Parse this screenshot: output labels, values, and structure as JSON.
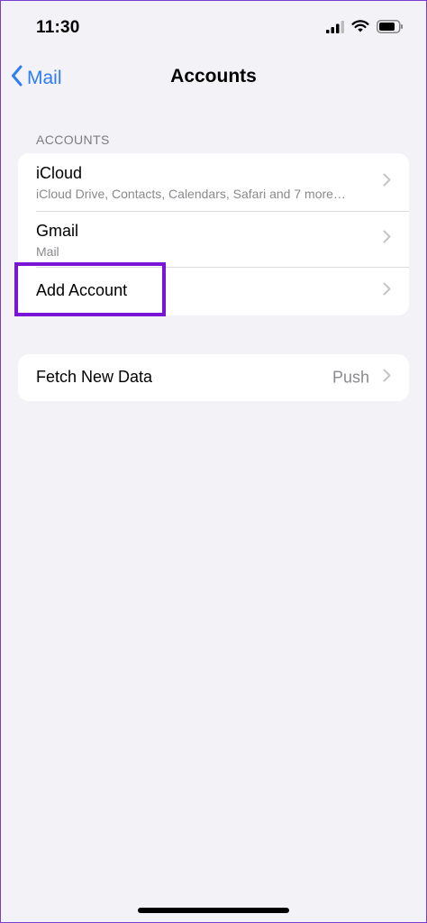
{
  "status_bar": {
    "time": "11:30"
  },
  "nav": {
    "back_label": "Mail",
    "title": "Accounts"
  },
  "accounts_section": {
    "header": "ACCOUNTS",
    "items": [
      {
        "title": "iCloud",
        "subtitle": "iCloud Drive, Contacts, Calendars, Safari and 7 more…"
      },
      {
        "title": "Gmail",
        "subtitle": "Mail"
      },
      {
        "title": "Add Account"
      }
    ]
  },
  "fetch_section": {
    "title": "Fetch New Data",
    "value": "Push"
  },
  "colors": {
    "accent": "#2f7cf6",
    "highlight": "#7a14d6",
    "background": "#f2f2f7"
  },
  "icons": [
    "signal-icon",
    "wifi-icon",
    "battery-icon",
    "back-chevron-icon",
    "chevron-right-icon"
  ]
}
